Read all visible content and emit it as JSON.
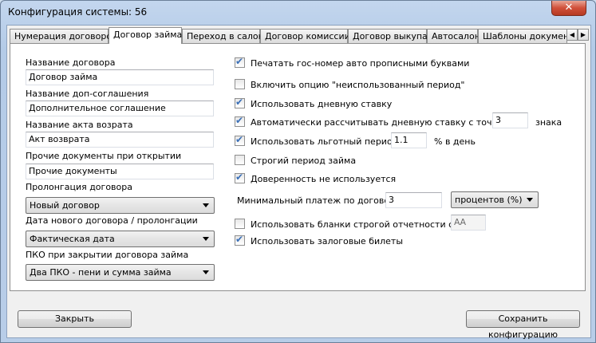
{
  "window": {
    "title": "Конфигурация системы: 56",
    "close_glyph": "✕"
  },
  "tabs": [
    {
      "label": "Нумерация договоров"
    },
    {
      "label": "Договор займа"
    },
    {
      "label": "Переход в салон"
    },
    {
      "label": "Договор комиссии"
    },
    {
      "label": "Договор выкупа"
    },
    {
      "label": "Автосалон"
    },
    {
      "label": "Шаблоны документов"
    }
  ],
  "tab_scroll": {
    "left": "◀",
    "right": "▶"
  },
  "left": {
    "contract_name": {
      "label": "Название договора",
      "value": "Договор займа"
    },
    "addendum_name": {
      "label": "Название доп-соглашения",
      "value": "Дополнительное соглашение"
    },
    "return_act_name": {
      "label": "Название акта возрата",
      "value": "Акт возврата"
    },
    "other_docs": {
      "label": "Прочие документы при открытии",
      "value": "Прочие документы"
    },
    "prolongation": {
      "label": "Пролонгация договора",
      "value": "Новый договор"
    },
    "new_contract_date": {
      "label": "Дата нового договора / пролонгации",
      "value": "Фактическая дата"
    },
    "pko_on_close": {
      "label": "ПКО при закрытии договора займа",
      "value": "Два ПКО - пени и сумма займа"
    }
  },
  "right": {
    "print_plate_caps": {
      "label": "Печатать гос-номер авто прописными буквами",
      "checked": true
    },
    "unused_period": {
      "label": "Включить опцию \"неиспользованный период\"",
      "checked": false
    },
    "daily_rate": {
      "label": "Использовать дневную ставку",
      "checked": true
    },
    "auto_daily_rate": {
      "label": "Автоматически рассчитывать дневную ставку с точностью",
      "checked": true,
      "value": "3",
      "suffix": "знака"
    },
    "grace_period": {
      "label": "Использовать льготный период",
      "checked": true,
      "value": "1.1",
      "suffix": "% в день"
    },
    "strict_loan_period": {
      "label": "Строгий период займа",
      "checked": false
    },
    "no_power_of_attorney": {
      "label": "Доверенность не используется",
      "checked": true
    },
    "min_payment": {
      "label": "Минимальный платеж по договору",
      "value": "3",
      "unit": "процентов (%)"
    },
    "strict_forms": {
      "label": "Использовать бланки строгой отчетности серии",
      "checked": false,
      "value": "АА"
    },
    "pledge_tickets": {
      "label": "Использовать залоговые билеты",
      "checked": true
    }
  },
  "footer": {
    "close_label": "Закрыть",
    "save_label": "Сохранить конфигурацию"
  },
  "colors": {
    "accent": "#3a6fb7",
    "close_red": "#d0503a"
  }
}
